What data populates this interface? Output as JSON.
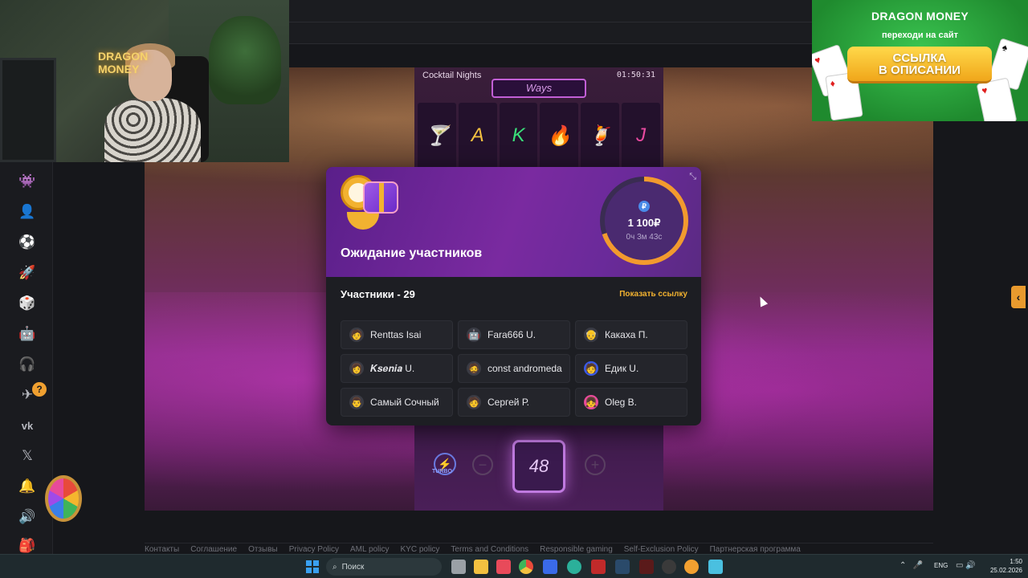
{
  "webcam": {
    "sign_text": "DRAGON MONEY"
  },
  "ad": {
    "brand": "DRAGON MONEY",
    "subtitle": "переходи на сайт",
    "button_line1": "ССЫЛКА",
    "button_line2": "В ОПИСАНИИ"
  },
  "game": {
    "title": "Cocktail Nights",
    "time": "01:50:31",
    "ways_label": "Ways",
    "turbo_label": "TURBO",
    "bet_value": "48"
  },
  "modal": {
    "title": "Ожидание участников",
    "prize_amount": "1 100₽",
    "timer": "0ч 3м 43с",
    "currency_symbol": "₽",
    "participants_label": "Участники - 29",
    "show_link_label": "Показать ссылку",
    "participants": [
      {
        "name": "Renttas Isai",
        "icon": "avatar-icon"
      },
      {
        "name": "Fara666 U.",
        "icon": "avatar-icon"
      },
      {
        "name": "Какаха П.",
        "icon": "avatar-icon"
      },
      {
        "name": "𝑲𝒔𝒆𝒏𝒊𝒂 U.",
        "icon": "avatar-icon"
      },
      {
        "name": "const andromeda",
        "icon": "avatar-icon"
      },
      {
        "name": "Едик U.",
        "icon": "avatar-icon"
      },
      {
        "name": "Самый Сочный",
        "icon": "avatar-icon"
      },
      {
        "name": "Сергей Р.",
        "icon": "avatar-icon"
      },
      {
        "name": "Oleg B.",
        "icon": "avatar-icon"
      }
    ]
  },
  "footer": {
    "links": [
      "Контакты",
      "Соглашение",
      "Отзывы",
      "Privacy Policy",
      "AML policy",
      "KYC policy",
      "Terms and Conditions",
      "Responsible gaming",
      "Self-Exclusion Policy",
      "Партнерская программа"
    ]
  },
  "sidebar": {
    "badge": "?",
    "icons": [
      "alien-icon",
      "user-icon",
      "ball-icon",
      "rocket-icon",
      "dice-icon",
      "robot-icon",
      "support-icon",
      "telegram-icon",
      "vk-icon",
      "x-icon",
      "bell-icon",
      "sound-icon",
      "bag-icon"
    ]
  },
  "taskbar": {
    "search_placeholder": "Поиск",
    "lang": "ENG",
    "time": "1:50",
    "date": "25.02.2026"
  },
  "colors": {
    "accent": "#f2b230",
    "modal_header": "#6a2a9a",
    "ring_progress": "#f29a2e",
    "sidebar_active": "#2bd07a"
  }
}
